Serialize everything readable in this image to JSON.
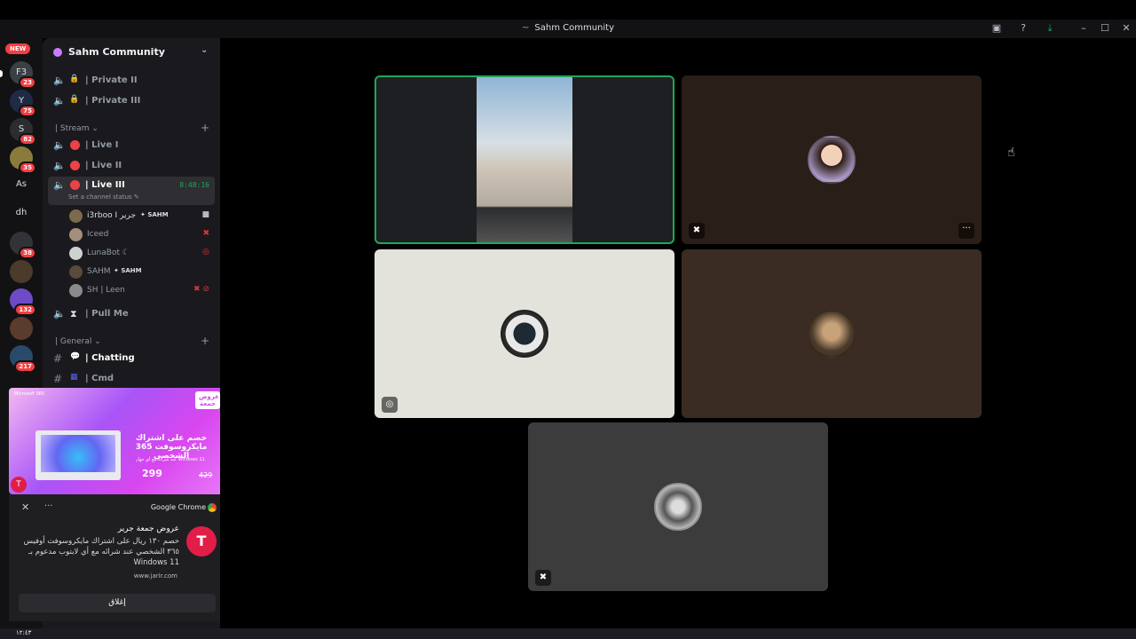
{
  "window": {
    "title": "Sahm Community"
  },
  "rail": {
    "new_label": "NEW",
    "servers": [
      {
        "label": "F3",
        "badge": "23"
      },
      {
        "label": "Y",
        "badge": "75"
      },
      {
        "label": "S",
        "badge": "82"
      },
      {
        "label": "",
        "badge": "35"
      },
      {
        "label": "As",
        "badge": ""
      },
      {
        "label": "dh",
        "badge": ""
      },
      {
        "label": "",
        "badge": "38"
      },
      {
        "label": "",
        "badge": ""
      },
      {
        "label": "",
        "badge": "132"
      },
      {
        "label": "",
        "badge": ""
      },
      {
        "label": "",
        "badge": "217"
      }
    ]
  },
  "guild": {
    "name": "Sahm Community"
  },
  "channels": {
    "private": [
      {
        "label": "| Private II"
      },
      {
        "label": "| Private III"
      }
    ],
    "stream_category": "| Stream",
    "stream": [
      {
        "label": "| Live I"
      },
      {
        "label": "| Live II"
      },
      {
        "label": "| Live III",
        "timer": "8:48:16",
        "status_hint": "Set a channel status"
      }
    ],
    "voice_users": [
      {
        "name": "i3rboo I جرير",
        "tag": "SAHM"
      },
      {
        "name": "Iceed",
        "tag": ""
      },
      {
        "name": "LunaBot",
        "tag": ""
      },
      {
        "name": "SAHM",
        "tag": "SAHM"
      },
      {
        "name": "SH | Leen",
        "tag": ""
      }
    ],
    "pull": {
      "label": "| Pull Me"
    },
    "general_category": "| General",
    "general": [
      {
        "label": "| Chatting"
      },
      {
        "label": "| Cmd"
      }
    ]
  },
  "ad": {
    "brand": "Microsoft 365",
    "promo": "عروض جمعة",
    "title": "خصم على اشتراك مايكروسوفت 365 الشخصي",
    "subtitle": "عند شرائه مع أي جهاز Windows 11",
    "price": "299",
    "old_price": "429"
  },
  "notification": {
    "source": "Google Chrome",
    "heading": "عروض جمعة جرير",
    "body": "خصم ١٣٠ ريال على اشتراك مايكروسوفت أوفيس ٣٦٥ الشخصي عند شرائه مع أي لابتوب مدعوم بـ Windows 11",
    "url": "www.jarir.com",
    "dismiss_label": "إغلاق"
  },
  "taskbar": {
    "clock": "١٢:٤٣"
  },
  "colors": {
    "speaking_border": "#23a55a",
    "live": "#ed4245",
    "badge": "#f23f43"
  }
}
